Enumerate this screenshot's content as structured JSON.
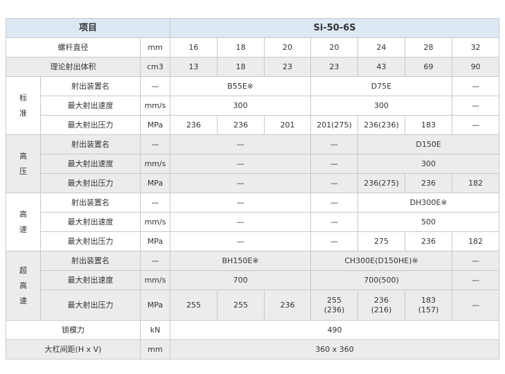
{
  "header": {
    "item_label": "项目",
    "model": "Si-50-6S"
  },
  "screw": {
    "label": "螺杆直径",
    "unit": "mm",
    "values": [
      "16",
      "18",
      "20",
      "20",
      "24",
      "28",
      "32"
    ]
  },
  "volume": {
    "label": "理论射出体积",
    "unit": "cm3",
    "values": [
      "13",
      "18",
      "23",
      "23",
      "43",
      "69",
      "90"
    ]
  },
  "standard": {
    "cat": [
      "标",
      "准"
    ],
    "unit_name": {
      "label": "射出装置名",
      "unit": "—",
      "v1": "B55E※",
      "v2": "D75E",
      "v3": "—"
    },
    "speed": {
      "label": "最大射出速度",
      "unit": "mm/s",
      "v1": "300",
      "v2": "300",
      "v3": "—"
    },
    "pressure": {
      "label": "最大射出压力",
      "unit": "MPa",
      "values": [
        "236",
        "236",
        "201",
        "201(275)",
        "236(236)",
        "183",
        "—"
      ]
    }
  },
  "high_pressure": {
    "cat": [
      "高",
      "压"
    ],
    "unit_name": {
      "label": "射出装置名",
      "unit": "—",
      "v1": "—",
      "v2": "—",
      "v3": "D150E"
    },
    "speed": {
      "label": "最大射出速度",
      "unit": "mm/s",
      "v1": "—",
      "v2": "—",
      "v3": "300"
    },
    "pressure": {
      "label": "最大射出压力",
      "unit": "MPa",
      "v1": "—",
      "v2": "—",
      "v3": "236(275)",
      "v4": "236",
      "v5": "182"
    }
  },
  "high_speed": {
    "cat": [
      "高",
      "速"
    ],
    "unit_name": {
      "label": "射出装置名",
      "unit": "—",
      "v1": "—",
      "v2": "—",
      "v3": "DH300E※"
    },
    "speed": {
      "label": "最大射出速度",
      "unit": "mm/s",
      "v1": "—",
      "v2": "—",
      "v3": "500"
    },
    "pressure": {
      "label": "最大射出压力",
      "unit": "MPa",
      "v1": "—",
      "v2": "—",
      "v3": "275",
      "v4": "236",
      "v5": "182"
    }
  },
  "ultra_speed": {
    "cat": [
      "超",
      "高",
      "速"
    ],
    "unit_name": {
      "label": "射出装置名",
      "unit": "—",
      "v1": "BH150E※",
      "v2": "CH300E(D150HE)※",
      "v3": "—"
    },
    "speed": {
      "label": "最大射出速度",
      "unit": "mm/s",
      "v1": "700",
      "v2": "700(500)",
      "v3": "—"
    },
    "pressure": {
      "label": "最大射出压力",
      "unit": "MPa",
      "values": [
        [
          "255"
        ],
        [
          "255"
        ],
        [
          "236"
        ],
        [
          "255",
          "(236)"
        ],
        [
          "236",
          "(216)"
        ],
        [
          "183",
          "(157)"
        ],
        [
          "—"
        ]
      ]
    }
  },
  "clamp": {
    "label": "锁模力",
    "unit": "kN",
    "value": "490"
  },
  "tiebar": {
    "label": "大杠间距(H x V)",
    "unit": "mm",
    "value": "360 x 360"
  }
}
